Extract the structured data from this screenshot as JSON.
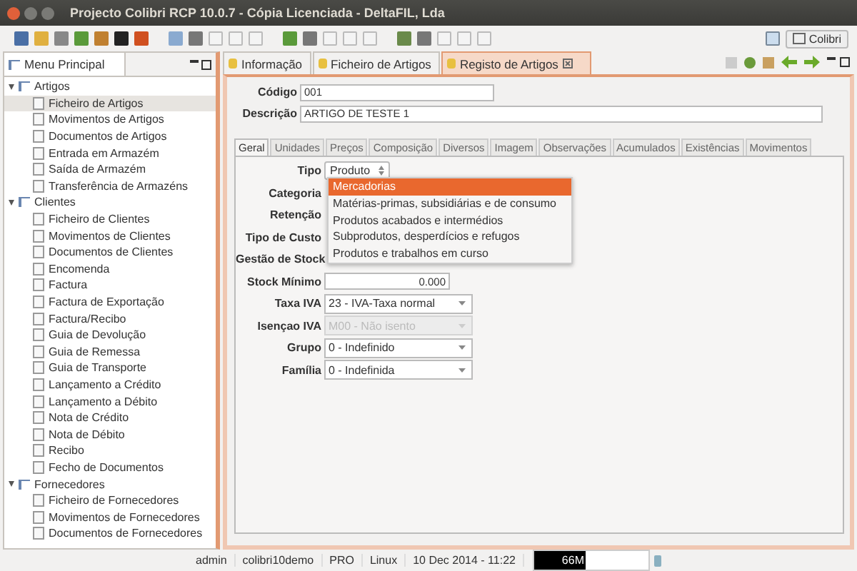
{
  "window": {
    "title": "Projecto Colibri RCP 10.0.7 - Cópia Licenciada - DeltaFIL, Lda"
  },
  "perspective": {
    "label": "Colibri"
  },
  "sidebar": {
    "title": "Menu Principal",
    "items": [
      {
        "label": "Artigos",
        "expanded": true,
        "selected": false,
        "children": [
          {
            "label": "Ficheiro de Artigos",
            "selected": true
          },
          {
            "label": "Movimentos de Artigos",
            "selected": false
          },
          {
            "label": "Documentos de Artigos",
            "selected": false
          },
          {
            "label": "Entrada em Armazém",
            "selected": false
          },
          {
            "label": "Saída de Armazém",
            "selected": false
          },
          {
            "label": "Transferência de Armazéns",
            "selected": false
          }
        ]
      },
      {
        "label": "Clientes",
        "expanded": true,
        "selected": false,
        "children": [
          {
            "label": "Ficheiro de Clientes",
            "selected": false
          },
          {
            "label": "Movimentos de Clientes",
            "selected": false
          },
          {
            "label": "Documentos de Clientes",
            "selected": false
          },
          {
            "label": "Encomenda",
            "selected": false
          },
          {
            "label": "Factura",
            "selected": false
          },
          {
            "label": "Factura de Exportação",
            "selected": false
          },
          {
            "label": "Factura/Recibo",
            "selected": false
          },
          {
            "label": "Guia de Devolução",
            "selected": false
          },
          {
            "label": "Guia de Remessa",
            "selected": false
          },
          {
            "label": "Guia de Transporte",
            "selected": false
          },
          {
            "label": "Lançamento a Crédito",
            "selected": false
          },
          {
            "label": "Lançamento a Débito",
            "selected": false
          },
          {
            "label": "Nota de Crédito",
            "selected": false
          },
          {
            "label": "Nota de Débito",
            "selected": false
          },
          {
            "label": "Recibo",
            "selected": false
          },
          {
            "label": "Fecho de Documentos",
            "selected": false
          }
        ]
      },
      {
        "label": "Fornecedores",
        "expanded": true,
        "selected": false,
        "children": [
          {
            "label": "Ficheiro de Fornecedores",
            "selected": false
          },
          {
            "label": "Movimentos de Fornecedores",
            "selected": false
          },
          {
            "label": "Documentos de Fornecedores",
            "selected": false
          }
        ]
      }
    ]
  },
  "editor_tabs": [
    {
      "label": "Informação",
      "selected": false
    },
    {
      "label": "Ficheiro de Artigos",
      "selected": false
    },
    {
      "label": "Registo de Artigos",
      "selected": true
    }
  ],
  "header_fields": [
    {
      "label": "Código",
      "value": "001"
    },
    {
      "label": "Descrição",
      "value": "ARTIGO DE TESTE 1"
    }
  ],
  "form_tabs": [
    {
      "label": "Geral",
      "selected": true
    },
    {
      "label": "Unidades",
      "selected": false
    },
    {
      "label": "Preços",
      "selected": false
    },
    {
      "label": "Composição",
      "selected": false
    },
    {
      "label": "Diversos",
      "selected": false
    },
    {
      "label": "Imagem",
      "selected": false
    },
    {
      "label": "Observações",
      "selected": false
    },
    {
      "label": "Acumulados",
      "selected": false
    },
    {
      "label": "Existências",
      "selected": false
    },
    {
      "label": "Movimentos",
      "selected": false
    }
  ],
  "fields": [
    {
      "label": "Tipo",
      "kind": "spin",
      "value": "Produto"
    },
    {
      "label": "Categoria",
      "kind": "hidden"
    },
    {
      "label": "Retenção",
      "kind": "hidden"
    },
    {
      "label": "Tipo de Custo",
      "kind": "hidden"
    },
    {
      "label": "Gestão de Stock",
      "kind": "hidden"
    },
    {
      "label": "Stock Mínimo",
      "kind": "number",
      "value": "0.000"
    },
    {
      "label": "Taxa IVA",
      "kind": "combo",
      "value": "23 - IVA-Taxa normal",
      "disabled": false
    },
    {
      "label": "Isençao IVA",
      "kind": "combo",
      "value": "M00 - Não isento",
      "disabled": true
    },
    {
      "label": "Grupo",
      "kind": "combo",
      "value": "0 - Indefinido",
      "disabled": false
    },
    {
      "label": "Família",
      "kind": "combo",
      "value": "0 - Indefinida",
      "disabled": false
    }
  ],
  "dropdown": {
    "options": [
      {
        "label": "Mercadorias",
        "selected": true
      },
      {
        "label": "Matérias-primas, subsidiárias e de consumo",
        "selected": false
      },
      {
        "label": "Produtos acabados e intermédios",
        "selected": false
      },
      {
        "label": "Subprodutos, desperdícios e refugos",
        "selected": false
      },
      {
        "label": "Produtos e trabalhos em curso",
        "selected": false
      }
    ]
  },
  "status_bar": {
    "items": [
      "admin",
      "colibri10demo",
      "PRO",
      "Linux",
      "10 Dec 2014 - 11:22"
    ],
    "memory": {
      "label": "66M",
      "level": 0.45
    }
  }
}
